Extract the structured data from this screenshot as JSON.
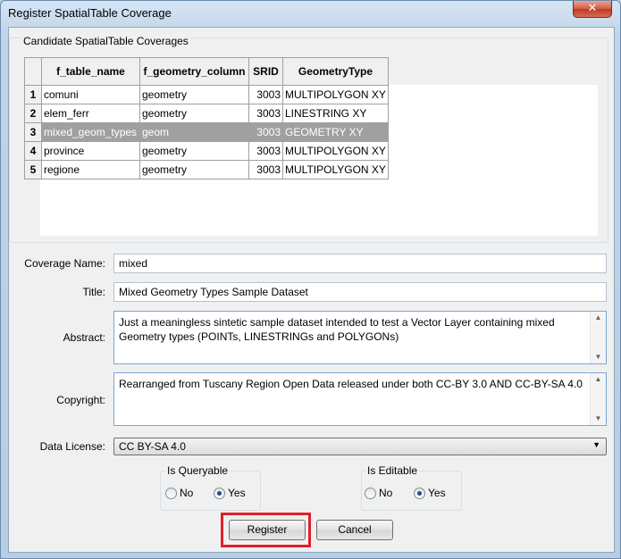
{
  "window": {
    "title": "Register SpatialTable Coverage",
    "close_glyph": "✕"
  },
  "group": {
    "title": "Candidate SpatialTable Coverages"
  },
  "grid": {
    "columns": [
      "f_table_name",
      "f_geometry_column",
      "SRID",
      "GeometryType"
    ],
    "rows": [
      {
        "num": "1",
        "name": "comuni",
        "geom": "geometry",
        "srid": "3003",
        "type": "MULTIPOLYGON XY"
      },
      {
        "num": "2",
        "name": "elem_ferr",
        "geom": "geometry",
        "srid": "3003",
        "type": "LINESTRING XY"
      },
      {
        "num": "3",
        "name": "mixed_geom_types",
        "geom": "geom",
        "srid": "3003",
        "type": "GEOMETRY XY"
      },
      {
        "num": "4",
        "name": "province",
        "geom": "geometry",
        "srid": "3003",
        "type": "MULTIPOLYGON XY"
      },
      {
        "num": "5",
        "name": "regione",
        "geom": "geometry",
        "srid": "3003",
        "type": "MULTIPOLYGON XY"
      }
    ],
    "selected_row": 3
  },
  "form": {
    "coverage_name_label": "Coverage Name:",
    "coverage_name_value": "mixed",
    "title_label": "Title:",
    "title_value": "Mixed Geometry Types Sample Dataset",
    "abstract_label": "Abstract:",
    "abstract_value": "Just a meaningless sintetic sample dataset intended to test a Vector Layer containing mixed Geometry types (POINTs, LINESTRINGs and POLYGONs)",
    "copyright_label": "Copyright:",
    "copyright_value": "Rearranged from Tuscany Region Open Data released under both CC-BY 3.0 AND CC-BY-SA 4.0",
    "license_label": "Data License:",
    "license_value": "CC BY-SA 4.0"
  },
  "queryable": {
    "title": "Is Queryable",
    "no": "No",
    "yes": "Yes",
    "selected": "Yes"
  },
  "editable": {
    "title": "Is Editable",
    "no": "No",
    "yes": "Yes",
    "selected": "Yes"
  },
  "buttons": {
    "register": "Register",
    "cancel": "Cancel"
  },
  "colors": {
    "highlight": "#e0202a",
    "selected_row": "#a0a0a0"
  }
}
